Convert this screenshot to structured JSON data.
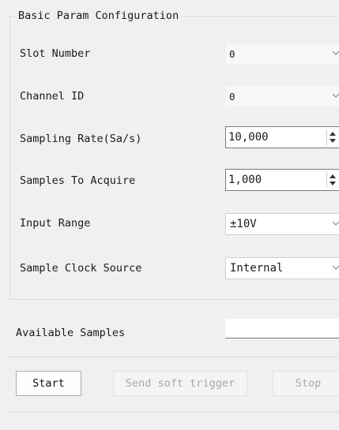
{
  "group": {
    "title": "Basic Param Configuration"
  },
  "fields": [
    {
      "label": "Slot Number",
      "value": "0"
    },
    {
      "label": "Channel ID",
      "value": "0"
    },
    {
      "label": "Sampling Rate(Sa/s)",
      "value": "10,000"
    },
    {
      "label": "Samples To Acquire",
      "value": "1,000"
    },
    {
      "label": "Input Range",
      "value": "±10V"
    },
    {
      "label": "Sample Clock Source",
      "value": "Internal"
    }
  ],
  "available": {
    "label": "Available Samples",
    "value": ""
  },
  "buttons": {
    "start": "Start",
    "send_trigger": "Send soft trigger",
    "stop": "Stop"
  },
  "colors": {
    "background": "#f0f0f0",
    "field_background": "#ffffff",
    "disabled_text": "#a8a8a8"
  },
  "icons": {
    "dropdown": "chevron-down-icon",
    "spin": "spin-arrows-icon"
  }
}
